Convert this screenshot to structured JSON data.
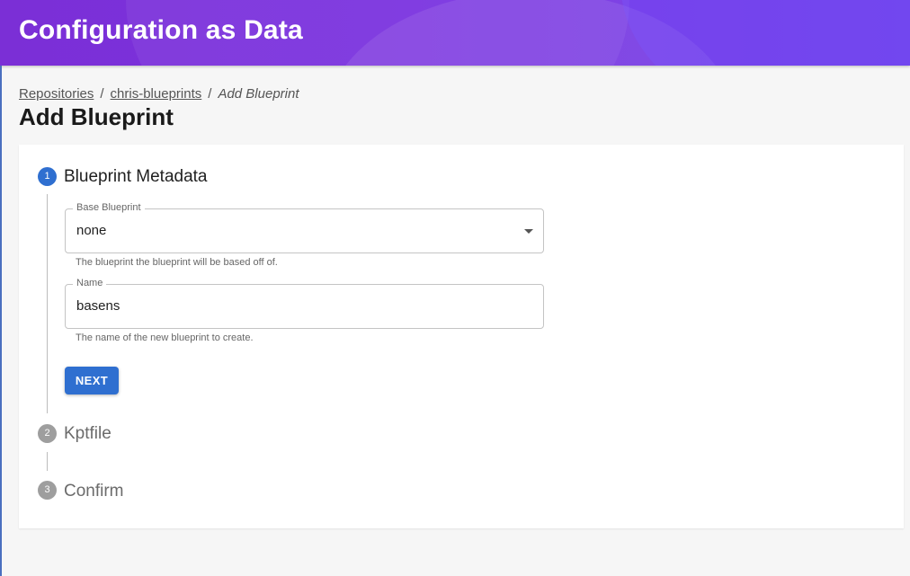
{
  "app": {
    "title": "Configuration as Data"
  },
  "breadcrumb": {
    "items": [
      "Repositories",
      "chris-blueprints"
    ],
    "separator": "/",
    "current": "Add Blueprint"
  },
  "page": {
    "title": "Add Blueprint"
  },
  "stepper": {
    "steps": [
      {
        "number": "1",
        "label": "Blueprint Metadata",
        "state": "active"
      },
      {
        "number": "2",
        "label": "Kptfile",
        "state": "inactive"
      },
      {
        "number": "3",
        "label": "Confirm",
        "state": "inactive"
      }
    ]
  },
  "form": {
    "base_blueprint": {
      "label": "Base Blueprint",
      "value": "none",
      "helper": "The blueprint the blueprint will be based off of."
    },
    "name": {
      "label": "Name",
      "value": "basens",
      "helper": "The name of the new blueprint to create."
    },
    "next_label": "NEXT"
  },
  "colors": {
    "header_start": "#7b2fd6",
    "header_end": "#6f3ee6",
    "primary": "#2f6fd0",
    "inactive_step": "#9e9e9e"
  }
}
